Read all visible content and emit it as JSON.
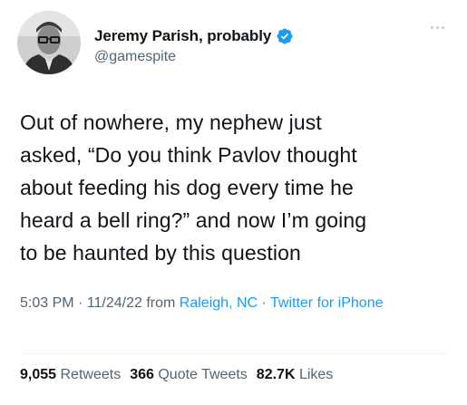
{
  "author": {
    "display_name": "Jeremy Parish, probably",
    "handle": "@gamespite",
    "verified": true,
    "avatar_icon": "person-with-glasses-avatar"
  },
  "tweet": {
    "lines": [
      "Out of nowhere, my nephew just",
      "asked, “Do you think Pavlov thought",
      "about feeding his dog every time he",
      "heard a bell ring?” and now I’m going",
      "to be haunted by this question"
    ]
  },
  "meta": {
    "time": "5:03 PM",
    "separator": " · ",
    "date": "11/24/22",
    "from_prefix": " from ",
    "location": "Raleigh, NC",
    "source": "Twitter for iPhone"
  },
  "stats": {
    "retweets_count": "9,055",
    "retweets_label": "Retweets",
    "quote_count": "366",
    "quote_label": "Quote Tweets",
    "likes_count": "82.7K",
    "likes_label": "Likes"
  },
  "colors": {
    "text": "#0f1419",
    "secondary": "#536471",
    "link": "#1d9bf0",
    "verified": "#1d9bf0",
    "divider": "#eff3f4"
  },
  "icons": {
    "verified": "verified-badge-icon",
    "more": "more-options-icon"
  }
}
